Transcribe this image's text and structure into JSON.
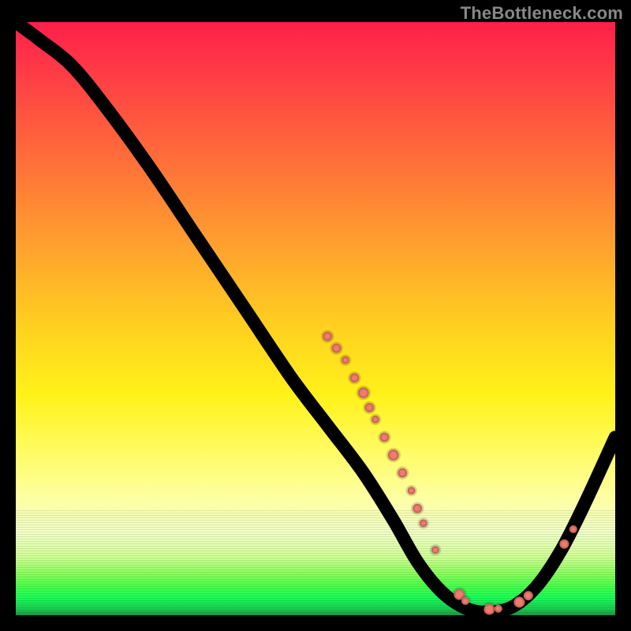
{
  "watermark": "TheBottleneck.com",
  "chart_data": {
    "type": "line",
    "title": "",
    "xlabel": "",
    "ylabel": "",
    "xlim": [
      0,
      100
    ],
    "ylim": [
      0,
      100
    ],
    "curve": [
      {
        "x": 0,
        "y": 100
      },
      {
        "x": 4,
        "y": 97
      },
      {
        "x": 9,
        "y": 93
      },
      {
        "x": 14,
        "y": 87
      },
      {
        "x": 22,
        "y": 76
      },
      {
        "x": 30,
        "y": 64
      },
      {
        "x": 38,
        "y": 52
      },
      {
        "x": 46,
        "y": 40
      },
      {
        "x": 52,
        "y": 32
      },
      {
        "x": 58,
        "y": 24
      },
      {
        "x": 63,
        "y": 16
      },
      {
        "x": 67,
        "y": 9
      },
      {
        "x": 71,
        "y": 4
      },
      {
        "x": 75,
        "y": 1.2
      },
      {
        "x": 79,
        "y": 0.5
      },
      {
        "x": 83,
        "y": 1.5
      },
      {
        "x": 87,
        "y": 5
      },
      {
        "x": 91,
        "y": 11
      },
      {
        "x": 95,
        "y": 19
      },
      {
        "x": 100,
        "y": 30
      }
    ],
    "scatter_on_curve": [
      {
        "x": 52,
        "y": 47,
        "r": 6
      },
      {
        "x": 53.5,
        "y": 45,
        "r": 6
      },
      {
        "x": 55,
        "y": 43,
        "r": 5
      },
      {
        "x": 56.5,
        "y": 40,
        "r": 6
      },
      {
        "x": 58,
        "y": 37.5,
        "r": 7
      },
      {
        "x": 59,
        "y": 35,
        "r": 6
      },
      {
        "x": 60,
        "y": 33,
        "r": 5
      },
      {
        "x": 61.5,
        "y": 30,
        "r": 6
      },
      {
        "x": 63,
        "y": 27,
        "r": 7
      },
      {
        "x": 64.5,
        "y": 24,
        "r": 6
      },
      {
        "x": 66,
        "y": 21,
        "r": 5
      },
      {
        "x": 67,
        "y": 18,
        "r": 6
      },
      {
        "x": 68,
        "y": 15.5,
        "r": 5
      },
      {
        "x": 70,
        "y": 11,
        "r": 5
      },
      {
        "x": 74,
        "y": 3.5,
        "r": 7
      },
      {
        "x": 75,
        "y": 2.4,
        "r": 5
      },
      {
        "x": 79,
        "y": 1.0,
        "r": 7
      },
      {
        "x": 80.5,
        "y": 1.1,
        "r": 5
      },
      {
        "x": 84,
        "y": 2.2,
        "r": 7
      },
      {
        "x": 85.5,
        "y": 3.3,
        "r": 6
      },
      {
        "x": 91.5,
        "y": 12,
        "r": 6
      },
      {
        "x": 93,
        "y": 14.5,
        "r": 5
      }
    ]
  }
}
